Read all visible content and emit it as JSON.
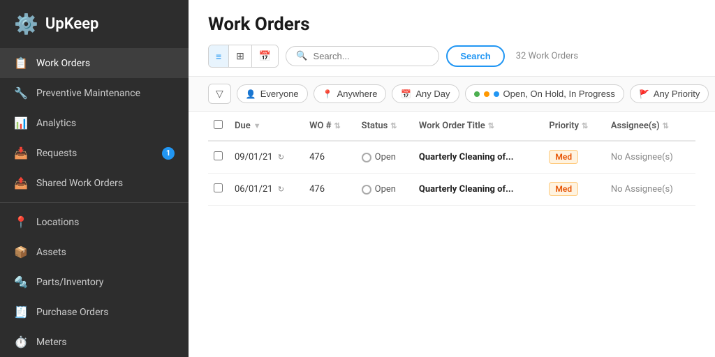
{
  "app": {
    "name": "UpKeep"
  },
  "sidebar": {
    "logo_text": "UpKeep",
    "items": [
      {
        "id": "work-orders",
        "label": "Work Orders",
        "icon": "📋",
        "active": true,
        "badge": null
      },
      {
        "id": "preventive-maintenance",
        "label": "Preventive Maintenance",
        "icon": "🔧",
        "active": false,
        "badge": null
      },
      {
        "id": "analytics",
        "label": "Analytics",
        "icon": "📊",
        "active": false,
        "badge": null
      },
      {
        "id": "requests",
        "label": "Requests",
        "icon": "📥",
        "active": false,
        "badge": "1"
      },
      {
        "id": "shared-work-orders",
        "label": "Shared Work Orders",
        "icon": "📤",
        "active": false,
        "badge": null
      },
      {
        "id": "locations",
        "label": "Locations",
        "icon": "📍",
        "active": false,
        "badge": null
      },
      {
        "id": "assets",
        "label": "Assets",
        "icon": "📦",
        "active": false,
        "badge": null
      },
      {
        "id": "parts-inventory",
        "label": "Parts/Inventory",
        "icon": "🔩",
        "active": false,
        "badge": null
      },
      {
        "id": "purchase-orders",
        "label": "Purchase Orders",
        "icon": "🧾",
        "active": false,
        "badge": null
      },
      {
        "id": "meters",
        "label": "Meters",
        "icon": "⏱️",
        "active": false,
        "badge": null
      }
    ]
  },
  "main": {
    "page_title": "Work Orders",
    "work_orders_count": "32 Work Orders",
    "search_placeholder": "Search...",
    "search_button_label": "Search",
    "view_buttons": [
      {
        "id": "list",
        "icon": "≡",
        "active": true
      },
      {
        "id": "grid",
        "icon": "⊞",
        "active": false
      },
      {
        "id": "calendar",
        "icon": "📅",
        "active": false
      }
    ],
    "filters": {
      "filter_icon_label": "▽",
      "everyone_label": "Everyone",
      "anywhere_label": "Anywhere",
      "any_day_label": "Any Day",
      "status_label": "Open, On Hold, In Progress",
      "any_priority_label": "Any Priority"
    },
    "table": {
      "columns": [
        {
          "id": "due",
          "label": "Due",
          "sortable": true
        },
        {
          "id": "wo_number",
          "label": "WO #",
          "sortable": true
        },
        {
          "id": "status",
          "label": "Status",
          "sortable": true
        },
        {
          "id": "title",
          "label": "Work Order Title",
          "sortable": true
        },
        {
          "id": "priority",
          "label": "Priority",
          "sortable": true
        },
        {
          "id": "assignees",
          "label": "Assignee(s)",
          "sortable": true
        }
      ],
      "rows": [
        {
          "due": "09/01/21",
          "wo_number": "476",
          "status": "Open",
          "title": "Quarterly Cleaning of...",
          "priority": "Med",
          "assignees": "No Assignee(s)"
        },
        {
          "due": "06/01/21",
          "wo_number": "476",
          "status": "Open",
          "title": "Quarterly Cleaning of...",
          "priority": "Med",
          "assignees": "No Assignee(s)"
        }
      ]
    }
  }
}
